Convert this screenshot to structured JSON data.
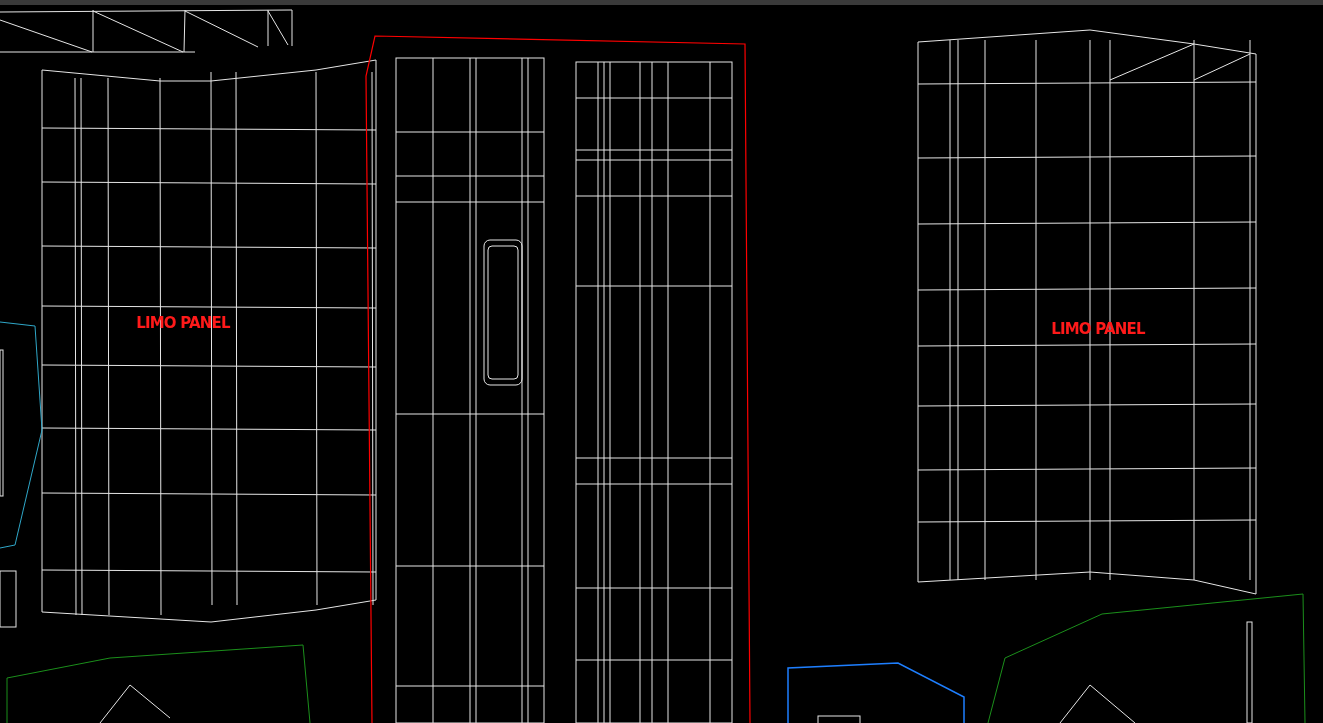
{
  "viewport": {
    "labels": [
      {
        "text": "LIMO PANEL"
      },
      {
        "text": "LIMO PANEL"
      }
    ]
  }
}
